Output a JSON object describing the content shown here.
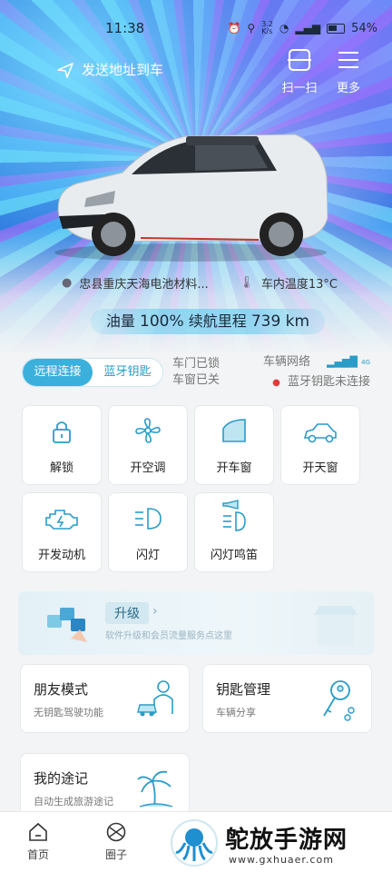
{
  "status_bar": {
    "time": "11:38",
    "net_speed": "3.2\nK/s",
    "battery": "54%"
  },
  "header": {
    "send_address": "发送地址到车",
    "scan_label": "扫一扫",
    "more_label": "更多"
  },
  "vehicle": {
    "location": "忠县重庆天海电池材料...",
    "cabin_temp": "车内温度13°C",
    "fuel_label": "油量",
    "fuel_value": "100%",
    "range_label": "续航里程",
    "range_value": "739 km"
  },
  "connection": {
    "remote_label": "远程连接",
    "bluetooth_label": "蓝牙钥匙",
    "door_status": "车门已锁",
    "window_status": "车窗已关",
    "network_label": "车辆网络",
    "network_badge": "4G",
    "bt_status": "蓝牙钥匙未连接"
  },
  "controls": [
    {
      "label": "解锁",
      "icon": "unlock-icon"
    },
    {
      "label": "开空调",
      "icon": "fan-icon"
    },
    {
      "label": "开车窗",
      "icon": "window-icon"
    },
    {
      "label": "开天窗",
      "icon": "sunroof-icon"
    },
    {
      "label": "开发动机",
      "icon": "engine-icon"
    },
    {
      "label": "闪灯",
      "icon": "headlight-icon"
    },
    {
      "label": "闪灯鸣笛",
      "icon": "horn-light-icon"
    }
  ],
  "upgrade": {
    "title": "升级",
    "subtitle": "软件升级和会员流量服务点这里"
  },
  "cards": {
    "friend_title": "朋友模式",
    "friend_sub": "无钥匙驾驶功能",
    "key_title": "钥匙管理",
    "key_sub": "车辆分享",
    "journey_title": "我的途记",
    "journey_sub": "自动生成旅游途记"
  },
  "tabbar": {
    "home_label": "首页",
    "circle_label": "圈子"
  },
  "watermark": {
    "name": "鸵放手游网",
    "url": "www.gxhuaer.com"
  },
  "colors": {
    "accent": "#3cb0dc",
    "icon": "#2a9cc8"
  }
}
